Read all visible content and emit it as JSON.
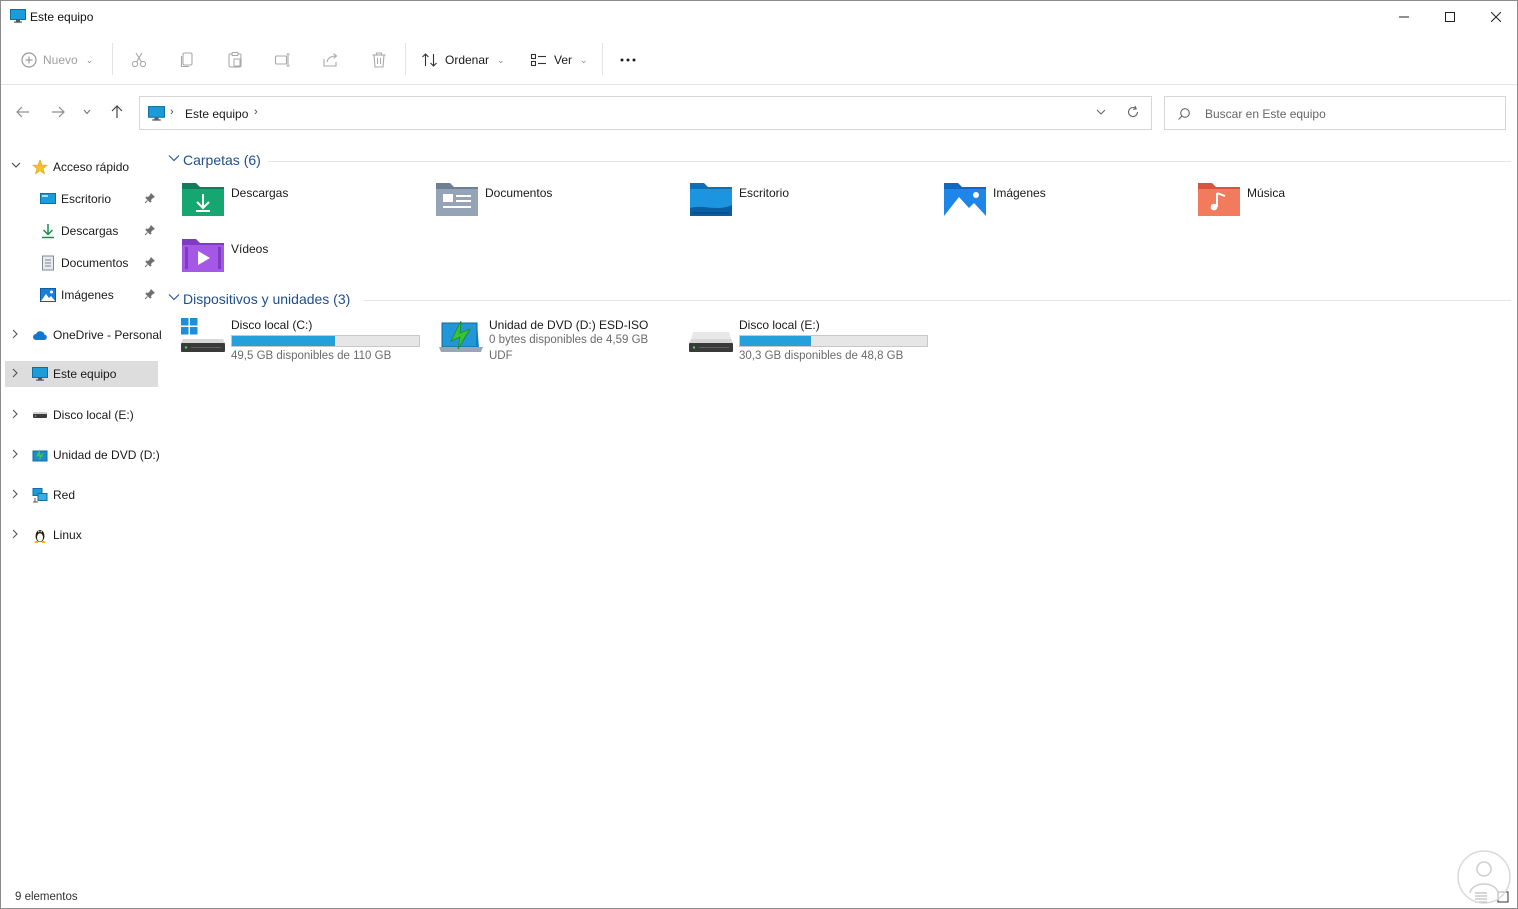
{
  "window": {
    "title": "Este equipo"
  },
  "commandbar": {
    "new_label": "Nuevo",
    "sort_label": "Ordenar",
    "view_label": "Ver"
  },
  "address": {
    "crumbs": [
      "Este equipo"
    ]
  },
  "search": {
    "placeholder": "Buscar en Este equipo"
  },
  "sidebar": {
    "items": [
      {
        "label": "Acceso rápido"
      },
      {
        "label": "Escritorio"
      },
      {
        "label": "Descargas"
      },
      {
        "label": "Documentos"
      },
      {
        "label": "Imágenes"
      },
      {
        "label": "OneDrive - Personal"
      },
      {
        "label": "Este equipo"
      },
      {
        "label": "Disco local (E:)"
      },
      {
        "label": "Unidad de DVD (D:)"
      },
      {
        "label": "Red"
      },
      {
        "label": "Linux"
      }
    ]
  },
  "folders_group": {
    "title": "Carpetas (6)",
    "items": [
      {
        "label": "Descargas"
      },
      {
        "label": "Documentos"
      },
      {
        "label": "Escritorio"
      },
      {
        "label": "Imágenes"
      },
      {
        "label": "Música"
      },
      {
        "label": "Vídeos"
      }
    ]
  },
  "devices_group": {
    "title": "Dispositivos y unidades (3)",
    "items": [
      {
        "name": "Disco local (C:)",
        "free_text": "49,5 GB disponibles de 110 GB",
        "used_fraction": 0.55
      },
      {
        "name": "Unidad de DVD (D:) ESD-ISO",
        "free_text": "0 bytes disponibles de 4,59 GB",
        "fs": "UDF"
      },
      {
        "name": "Disco local (E:)",
        "free_text": "30,3 GB disponibles de 48,8 GB",
        "used_fraction": 0.38
      }
    ]
  },
  "status": {
    "count": "9 elementos"
  },
  "colors": {
    "accent": "#1f4e8c",
    "progress": "#26a0da",
    "selected": "#dddddd"
  }
}
